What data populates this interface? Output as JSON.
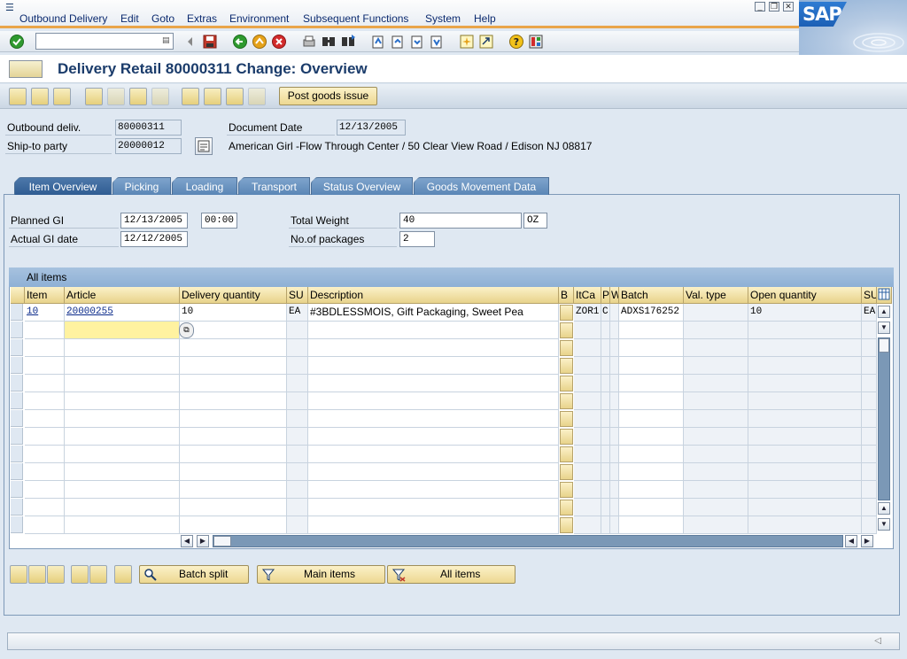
{
  "menubar": {
    "items": [
      "Outbound Delivery",
      "Edit",
      "Goto",
      "Extras",
      "Environment",
      "Subsequent Functions",
      "System",
      "Help"
    ]
  },
  "sap_logo": "SAP",
  "title": "Delivery Retail 80000311 Change: Overview",
  "app_toolbar": {
    "post_goods_issue": "Post goods issue"
  },
  "header": {
    "outbound_deliv_label": "Outbound deliv.",
    "outbound_deliv_value": "80000311",
    "ship_to_label": "Ship-to party",
    "ship_to_value": "20000012",
    "document_date_label": "Document Date",
    "document_date_value": "12/13/2005",
    "ship_to_address": "American Girl -Flow Through Center / 50 Clear View Road / Edison NJ 08817"
  },
  "tabs": [
    "Item Overview",
    "Picking",
    "Loading",
    "Transport",
    "Status Overview",
    "Goods Movement Data"
  ],
  "item_overview": {
    "planned_gi_label": "Planned GI",
    "planned_gi_date": "12/13/2005",
    "planned_gi_time": "00:00",
    "actual_gi_label": "Actual GI date",
    "actual_gi_date": "12/12/2005",
    "total_weight_label": "Total Weight",
    "total_weight_value": "40",
    "weight_unit": "OZ",
    "packages_label": "No.of packages",
    "packages_value": "2"
  },
  "table": {
    "title": "All items",
    "columns": [
      "Item",
      "Article",
      "Delivery quantity",
      "SU",
      "Description",
      "B",
      "ItCa",
      "P",
      "W",
      "Batch",
      "Val. type",
      "Open quantity",
      "SU"
    ],
    "rows": [
      {
        "item": "10",
        "article": "20000255",
        "delivery_quantity": "10",
        "su": "EA",
        "description": "#3BDLESSMOIS, Gift Packaging, Sweet Pea",
        "itca": "ZOR1",
        "p": "C",
        "batch": "ADXS176252",
        "val_type": "",
        "open_quantity": "10",
        "su2": "EA"
      }
    ]
  },
  "bottom_buttons": {
    "batch_split": "Batch split",
    "main_items": "Main items",
    "all_items": "All items"
  },
  "colors": {
    "tab_active": "#2f5c92",
    "accent_orange": "#e9a54a",
    "button_yellow": "#edd891"
  }
}
